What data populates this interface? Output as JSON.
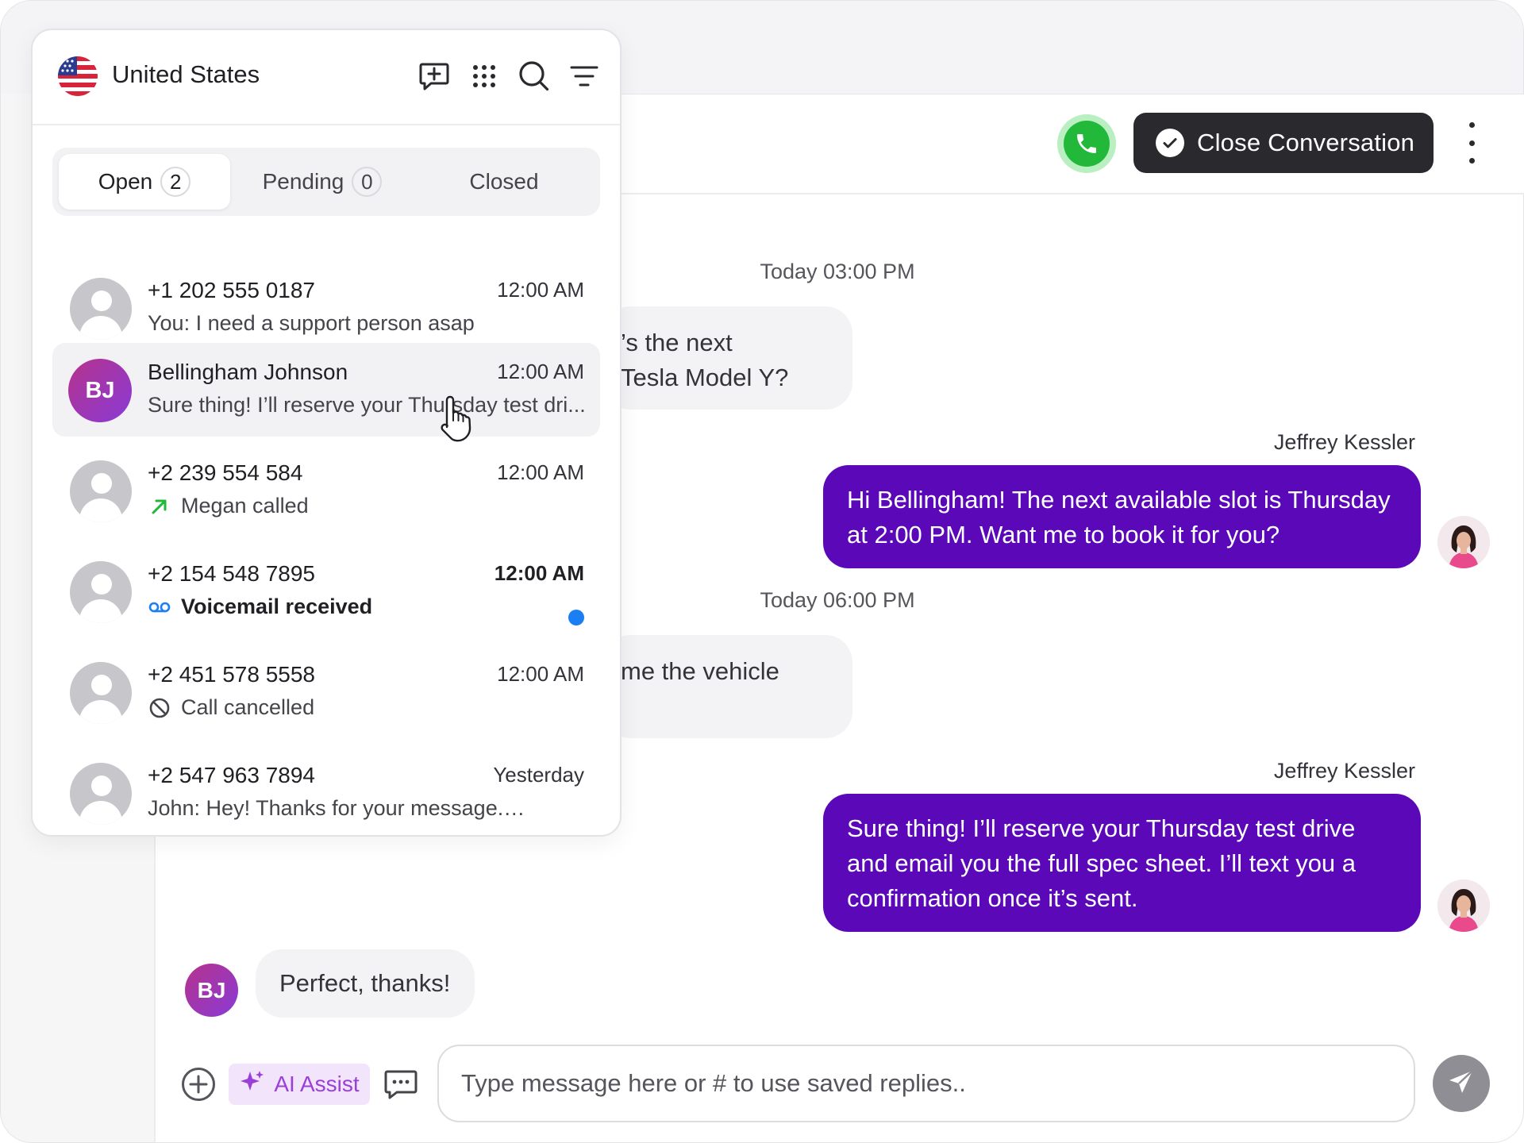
{
  "country": {
    "name": "United States",
    "flag_icon": "us-flag-icon"
  },
  "header_icons": [
    "new-message-icon",
    "dialpad-grid-icon",
    "search-icon",
    "filter-icon"
  ],
  "tabs": [
    {
      "label": "Open",
      "count": "2",
      "active": true
    },
    {
      "label": "Pending",
      "count": "0",
      "active": false
    },
    {
      "label": "Closed",
      "count": null,
      "active": false
    }
  ],
  "conversations": [
    {
      "name": "+1 202 555 0187",
      "time": "12:00 AM",
      "preview": "You: I need a support person asap",
      "avatar": "placeholder",
      "status_icon": null
    },
    {
      "name": "Bellingham Johnson",
      "time": "12:00 AM",
      "preview": "Sure thing! I’ll reserve your Thursday test dri...",
      "avatar": "initials",
      "initials": "BJ",
      "status_icon": null
    },
    {
      "name": "+2 239 554 584",
      "time": "12:00 AM",
      "preview": "Megan called",
      "avatar": "placeholder",
      "status_icon": "outgoing-call-icon"
    },
    {
      "name": "+2 154 548 7895",
      "time": "12:00 AM",
      "preview": "Voicemail received",
      "avatar": "placeholder",
      "status_icon": "voicemail-icon",
      "unread": true
    },
    {
      "name": "+2 451 578 5558",
      "time": "12:00 AM",
      "preview": "Call cancelled",
      "avatar": "placeholder",
      "status_icon": "call-cancelled-icon"
    },
    {
      "name": "+2 547 963 7894",
      "time": "Yesterday",
      "preview": "John: Hey! Thanks for your message.…",
      "avatar": "placeholder",
      "status_icon": null
    }
  ],
  "conversation_header": {
    "call_icon": "phone-icon",
    "close_button_label": "Close Conversation",
    "more_icon": "more-vertical-icon"
  },
  "messages": [
    {
      "type": "timestamp",
      "text": "Today 03:00 PM"
    },
    {
      "type": "incoming",
      "lines": [
        "’s the next",
        "Tesla Model Y?"
      ]
    },
    {
      "type": "outgoing",
      "sender": "Jeffrey Kessler",
      "text": "Hi Bellingham! The next available slot is Thursday at 2:00 PM. Want me to book it for you?"
    },
    {
      "type": "timestamp",
      "text": "Today 06:00 PM"
    },
    {
      "type": "incoming",
      "lines": [
        "me the vehicle"
      ]
    },
    {
      "type": "outgoing",
      "sender": "Jeffrey Kessler",
      "text": "Sure thing! I’ll reserve your Thursday test drive and email you the full spec sheet. I’ll text you a confirmation once it’s sent."
    },
    {
      "type": "incoming",
      "avatar_initials": "BJ",
      "text": "Perfect, thanks!"
    }
  ],
  "composer": {
    "placeholder": "Type message here or # to use saved replies..",
    "ai_assist_label": "AI Assist",
    "icons": [
      "add-icon",
      "sparkle-icon",
      "saved-replies-icon",
      "send-icon"
    ]
  },
  "colors": {
    "outgoing_bubble": "#5a08b8",
    "call_green": "#22b93b",
    "close_button_bg": "#2a2a2e",
    "unread_dot": "#1b7ef2",
    "ai_assist": "#9b3fd9"
  }
}
